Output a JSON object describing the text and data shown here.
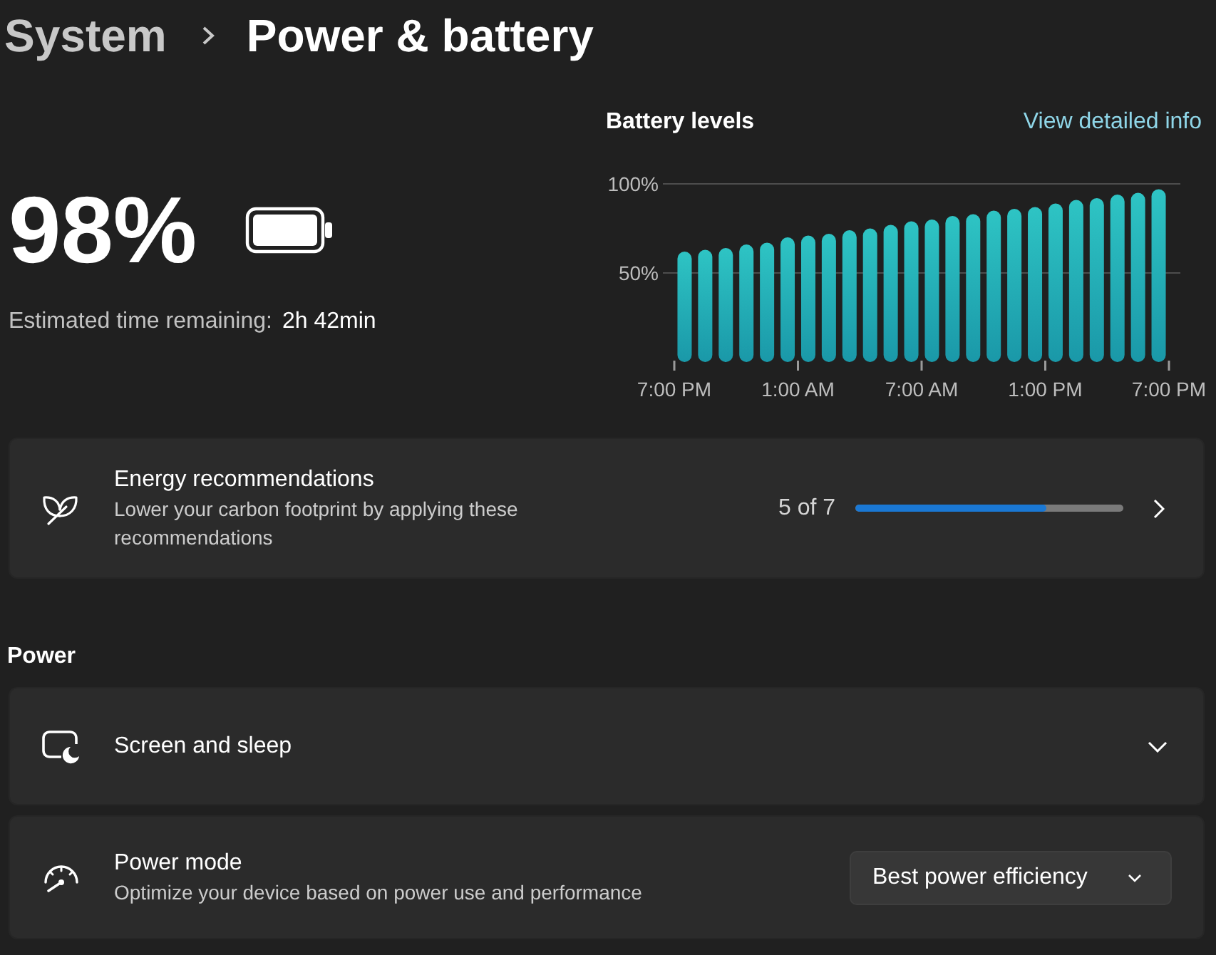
{
  "breadcrumb": {
    "parent": "System",
    "current": "Power & battery"
  },
  "battery": {
    "percent": "98%",
    "estimate_label": "Estimated time remaining:",
    "estimate_value": "2h 42min"
  },
  "battery_levels": {
    "link": "View detailed info",
    "chart_data": {
      "type": "bar",
      "title": "Battery levels",
      "categories": [
        "7:00 PM",
        null,
        null,
        null,
        null,
        null,
        "1:00 AM",
        null,
        null,
        null,
        null,
        null,
        "7:00 AM",
        null,
        null,
        null,
        null,
        null,
        "1:00 PM",
        null,
        null,
        null,
        null,
        "7:00 PM"
      ],
      "values": [
        62,
        63,
        64,
        66,
        67,
        70,
        71,
        72,
        74,
        75,
        77,
        79,
        80,
        82,
        83,
        85,
        86,
        87,
        89,
        91,
        92,
        94,
        95,
        97
      ],
      "ylim": [
        0,
        100
      ],
      "yticks": [
        {
          "value": 50,
          "label": "50%"
        },
        {
          "value": 100,
          "label": "100%"
        }
      ]
    }
  },
  "energy_recommendations": {
    "title": "Energy recommendations",
    "description": "Lower your carbon footprint by applying these recommendations",
    "progress": "5 of 7",
    "level": 0.714
  },
  "power": {
    "heading": "Power",
    "settings": [
      {
        "kind": "expander",
        "title": "Screen and sleep",
        "expanded": false
      },
      {
        "kind": "dropdown",
        "title": "Power mode",
        "description": "Optimize your device based on power use and performance",
        "value": "Best power efficiency"
      }
    ]
  }
}
